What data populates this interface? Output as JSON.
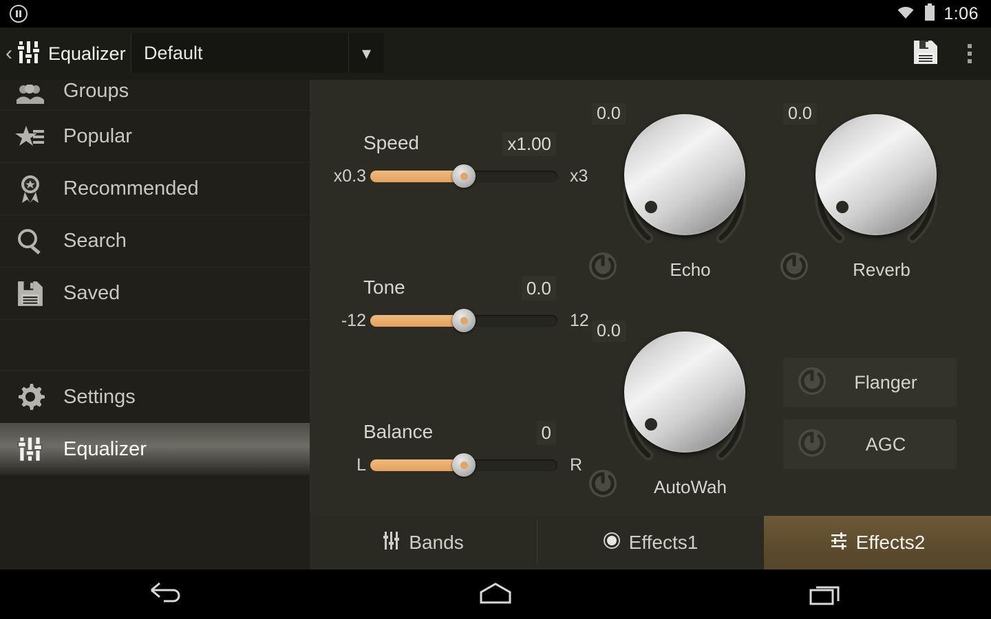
{
  "statusbar": {
    "pause_icon": "pause-icon",
    "wifi_icon": "wifi-icon",
    "battery_icon": "battery-icon",
    "clock": "1:06"
  },
  "actionbar": {
    "back_icon": "back-chevron-icon",
    "app_icon": "equalizer-sliders-icon",
    "title": "Equalizer",
    "preset_value": "Default",
    "preset_caret_icon": "chevron-down-icon",
    "save_icon": "save-floppy-icon",
    "overflow_icon": "overflow-menu-icon"
  },
  "sidebar": {
    "items": [
      {
        "label": "Groups",
        "icon": "groups-icon"
      },
      {
        "label": "Popular",
        "icon": "star-list-icon"
      },
      {
        "label": "Recommended",
        "icon": "award-ribbon-icon"
      },
      {
        "label": "Search",
        "icon": "search-icon"
      },
      {
        "label": "Saved",
        "icon": "save-floppy-icon"
      },
      {
        "label": "Settings",
        "icon": "gear-icon"
      },
      {
        "label": "Equalizer",
        "icon": "equalizer-sliders-icon"
      }
    ],
    "active": "Equalizer"
  },
  "main": {
    "sliders": [
      {
        "name": "Speed",
        "value": "x1.00",
        "min_label": "x0.3",
        "max_label": "x3",
        "percent": 50
      },
      {
        "name": "Tone",
        "value": "0.0",
        "min_label": "-12",
        "max_label": "12",
        "percent": 50
      },
      {
        "name": "Balance",
        "value": "0",
        "min_label": "L",
        "max_label": "R",
        "percent": 50
      }
    ],
    "knobs": [
      {
        "label": "Echo",
        "value": "0.0",
        "power_icon": "power-icon"
      },
      {
        "label": "Reverb",
        "value": "0.0",
        "power_icon": "power-icon"
      },
      {
        "label": "AutoWah",
        "value": "0.0",
        "power_icon": "power-icon"
      }
    ],
    "toggles": [
      {
        "label": "Flanger",
        "power_icon": "power-icon"
      },
      {
        "label": "AGC",
        "power_icon": "power-icon"
      }
    ]
  },
  "tabs": [
    {
      "label": "Bands",
      "icon": "bands-sliders-icon",
      "active": false
    },
    {
      "label": "Effects1",
      "icon": "effects1-dial-icon",
      "active": false
    },
    {
      "label": "Effects2",
      "icon": "effects2-sliders-icon",
      "active": true
    }
  ],
  "navbar": {
    "back_icon": "android-back-icon",
    "home_icon": "android-home-icon",
    "recents_icon": "android-recents-icon"
  },
  "colors": {
    "accent_orange": "#e8ad6b",
    "active_tab_brown": "#63502f",
    "panel_bg": "#2c2c24",
    "sidebar_bg": "#201f1a"
  }
}
